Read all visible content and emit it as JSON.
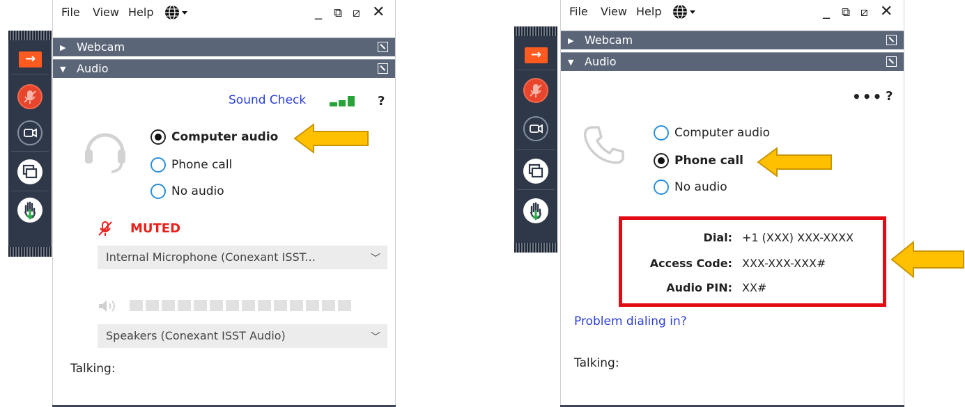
{
  "menu": {
    "file": "File",
    "view": "View",
    "help": "Help"
  },
  "sections": {
    "webcam": "Webcam",
    "audio": "Audio"
  },
  "left_panel": {
    "sound_check": "Sound Check",
    "help": "?",
    "options": [
      {
        "label": "Computer audio",
        "selected": true
      },
      {
        "label": "Phone call",
        "selected": false
      },
      {
        "label": "No audio",
        "selected": false
      }
    ],
    "muted": "MUTED",
    "microphone": "Internal Microphone (Conexant ISST...",
    "speakers": "Speakers (Conexant ISST Audio)",
    "talking": "Talking:"
  },
  "right_panel": {
    "more": "•••",
    "help": "?",
    "options": [
      {
        "label": "Computer audio",
        "selected": false
      },
      {
        "label": "Phone call",
        "selected": true
      },
      {
        "label": "No audio",
        "selected": false
      }
    ],
    "dial_label": "Dial:",
    "dial_value": "+1 (XXX) XXX-XXXX",
    "access_label": "Access Code:",
    "access_value": "XXX-XXX-XXX#",
    "pin_label": "Audio PIN:",
    "pin_value": "XX#",
    "problem_link": "Problem dialing in?",
    "talking": "Talking:"
  },
  "colors": {
    "bar": "#5b6578",
    "sidebar": "#2f3848",
    "accent_orange": "#ff5a1f",
    "muted_red": "#e8201b",
    "highlight_box": "#e20b13",
    "annotation_arrow": "#ffc000",
    "link": "#2b3fd6"
  }
}
